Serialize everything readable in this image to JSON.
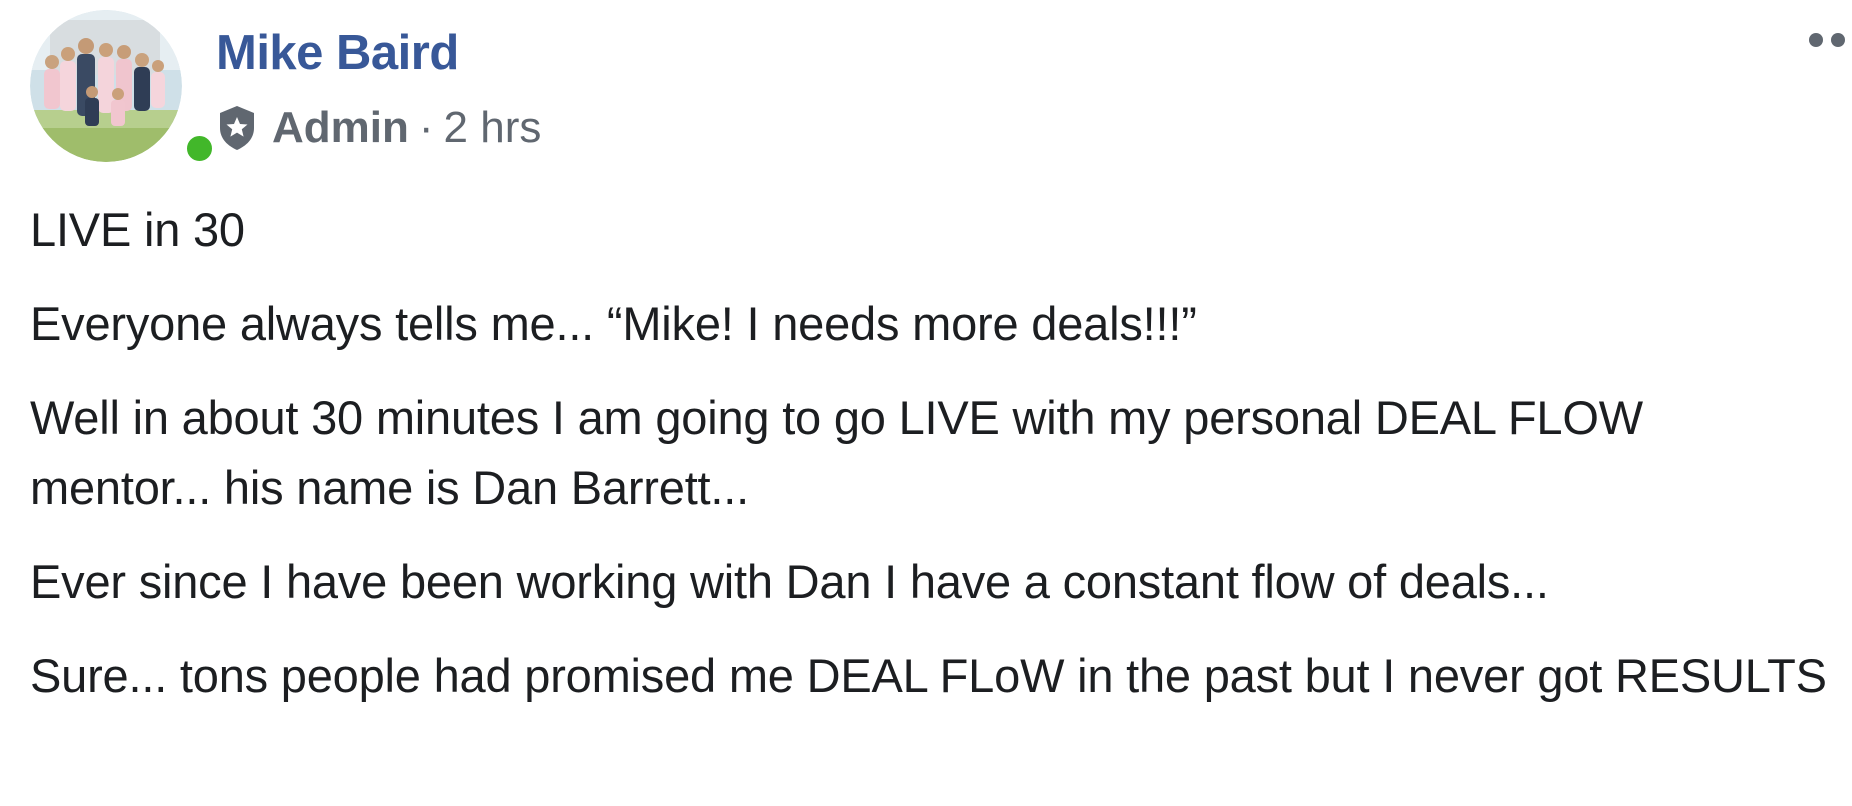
{
  "post": {
    "author": {
      "name": "Mike Baird",
      "role": "Admin",
      "separator": "·",
      "time": "2 hrs",
      "online": true
    },
    "paragraphs": [
      "LIVE in 30",
      "Everyone always tells me... “Mike! I needs more deals!!!”",
      "Well in about 30 minutes I am going to go LIVE with my personal DEAL FLOW mentor... his name is Dan Barrett...",
      "Ever since I have been working with Dan I have a constant flow of deals...",
      "Sure... tons people had promised me DEAL FLoW in the past but I never got RESULTS"
    ]
  },
  "colors": {
    "name_link": "#385898",
    "meta": "#606770",
    "text": "#1c1e21",
    "online": "#42b72a"
  },
  "icons": {
    "admin": "admin-shield-star-icon",
    "more": "more-options-icon"
  }
}
